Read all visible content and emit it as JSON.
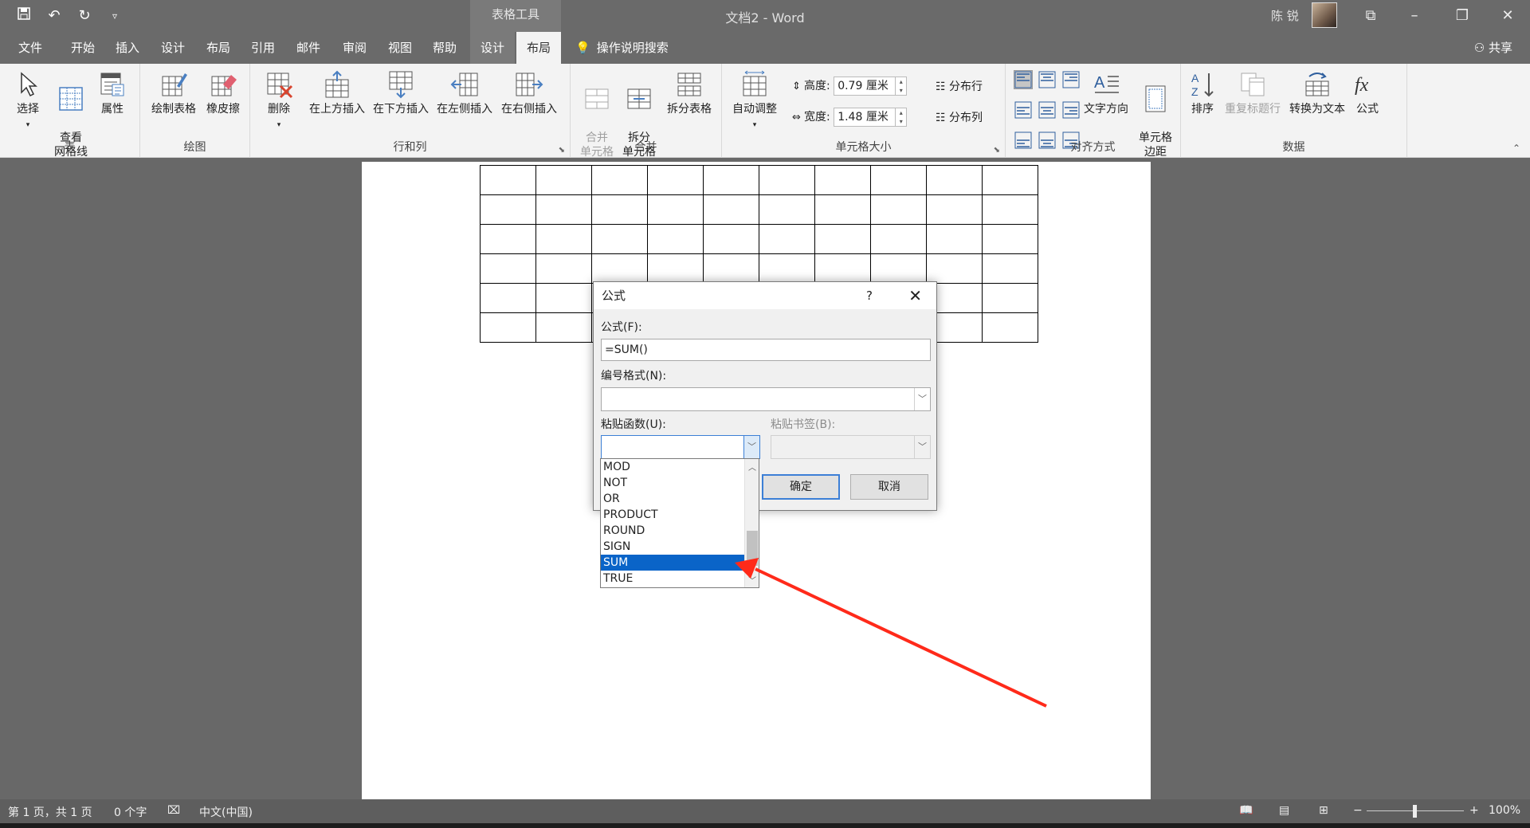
{
  "titlebar": {
    "context_tab": "表格工具",
    "document_title": "文档2 - Word",
    "user_name": "陈 锐",
    "qat_icons": [
      "save-icon",
      "undo-icon",
      "redo-icon",
      "customize-icon"
    ]
  },
  "ribbon_tabs": [
    {
      "label": "文件"
    },
    {
      "label": "开始"
    },
    {
      "label": "插入"
    },
    {
      "label": "设计"
    },
    {
      "label": "布局"
    },
    {
      "label": "引用"
    },
    {
      "label": "邮件"
    },
    {
      "label": "审阅"
    },
    {
      "label": "视图"
    },
    {
      "label": "帮助"
    },
    {
      "label": "设计"
    },
    {
      "label": "布局"
    }
  ],
  "tell_me": "操作说明搜索",
  "share": "共享",
  "ribbon": {
    "groups": {
      "table": "表",
      "draw": "绘图",
      "rows_cols": "行和列",
      "merge": "合并",
      "cell_size": "单元格大小",
      "alignment": "对齐方式",
      "data": "数据"
    },
    "buttons": {
      "select": "选择",
      "view_gridlines": "查看\n网格线",
      "properties": "属性",
      "draw_table": "绘制表格",
      "eraser": "橡皮擦",
      "delete": "删除",
      "insert_above": "在上方插入",
      "insert_below": "在下方插入",
      "insert_left": "在左侧插入",
      "insert_right": "在右侧插入",
      "merge_cells": "合并\n单元格",
      "split_cells": "拆分\n单元格",
      "split_table": "拆分表格",
      "autofit": "自动调整",
      "text_direction": "文字方向",
      "cell_margins": "单元格\n边距",
      "sort": "排序",
      "repeat_header": "重复标题行",
      "convert_to_text": "转换为文本",
      "formula": "公式",
      "distribute_rows": "分布行",
      "distribute_cols": "分布列"
    },
    "height_label": "高度:",
    "height_value": "0.79 厘米",
    "width_label": "宽度:",
    "width_value": "1.48 厘米"
  },
  "table": {
    "rows": 6,
    "cols": 10
  },
  "dialog": {
    "title": "公式",
    "help": "?",
    "formula_label": "公式(F):",
    "formula_value": "=SUM()",
    "number_format_label": "编号格式(N):",
    "number_format_value": "",
    "paste_function_label": "粘贴函数(U):",
    "paste_bookmark_label": "粘贴书签(B):",
    "ok": "确定",
    "cancel": "取消"
  },
  "function_list": {
    "items": [
      "MOD",
      "NOT",
      "OR",
      "PRODUCT",
      "ROUND",
      "SIGN",
      "SUM",
      "TRUE"
    ],
    "selected": "SUM"
  },
  "statusbar": {
    "page": "第 1 页，共 1 页",
    "words": "0 个字",
    "language": "中文(中国)",
    "zoom": "100%"
  },
  "colors": {
    "titlebar_bg": "#6a6a6a",
    "ribbon_bg": "#f3f3f3",
    "selection": "#0a64c8",
    "annotation_arrow": "#ff2a1a"
  }
}
